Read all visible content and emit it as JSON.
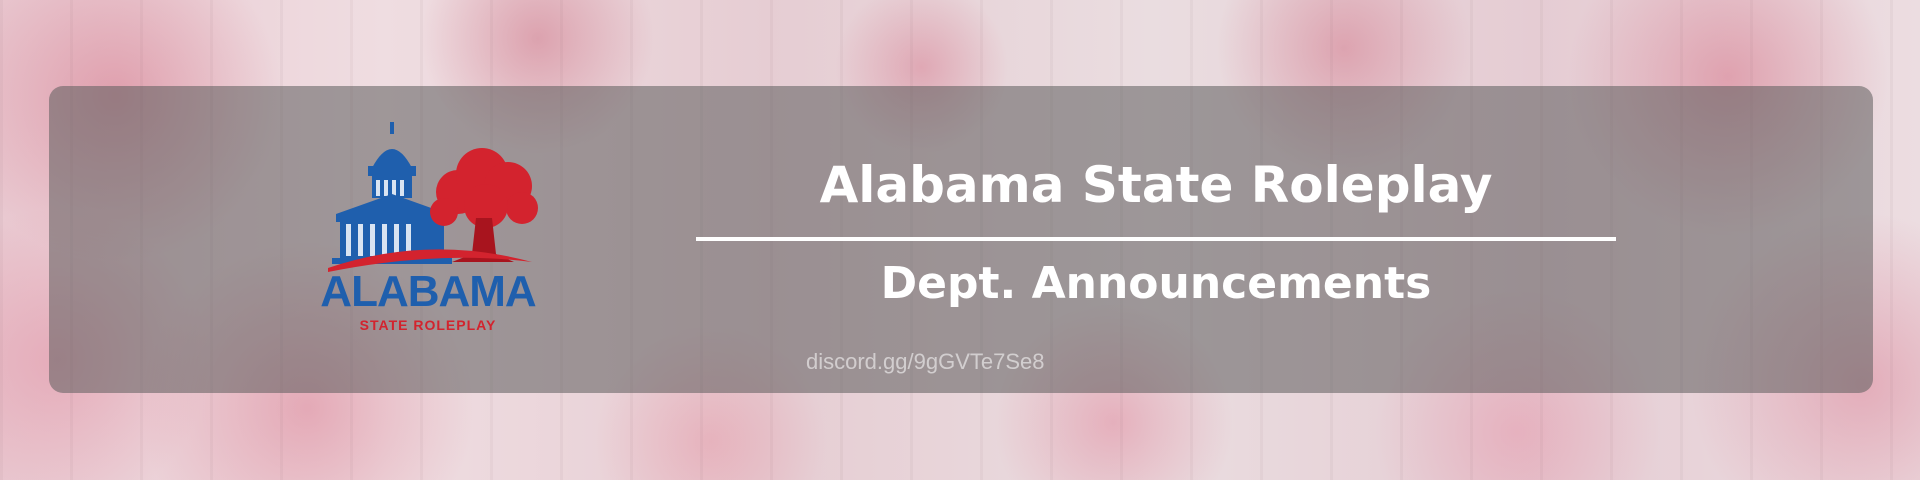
{
  "banner": {
    "title": "Alabama State Roleplay",
    "subtitle": "Dept. Announcements",
    "invite_link": "discord.gg/9gGVTe7Se8"
  },
  "logo": {
    "icon": "capitol-and-oak-tree-logo",
    "word": "ALABAMA",
    "tagline": "STATE ROLEPLAY"
  },
  "colors": {
    "logo_blue": "#1f5fad",
    "logo_red": "#d3232e",
    "panel_overlay": "#5c5c5c",
    "text": "#ffffff"
  }
}
